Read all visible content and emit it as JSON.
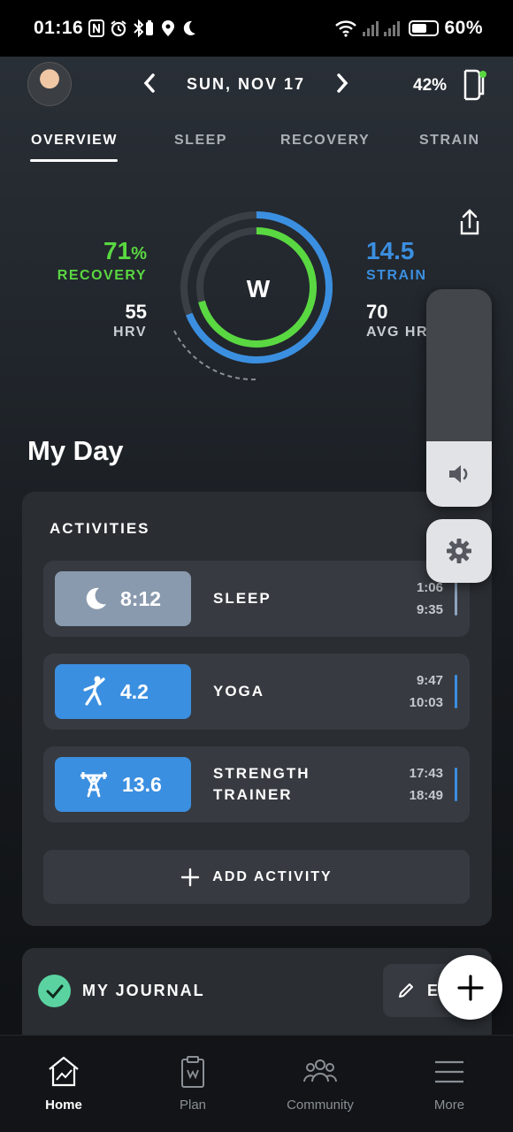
{
  "status_bar": {
    "time": "01:16",
    "battery_percent": "60%",
    "battery_level": 0.6,
    "icons": [
      "nfc-icon",
      "alarm-icon",
      "bluetooth-battery-icon",
      "location-icon",
      "moon-icon",
      "wifi-icon",
      "signal-icon",
      "signal-icon",
      "battery-icon"
    ]
  },
  "header": {
    "date": "SUN, NOV 17",
    "device_battery": "42%"
  },
  "tabs": [
    {
      "label": "OVERVIEW",
      "active": true
    },
    {
      "label": "SLEEP",
      "active": false
    },
    {
      "label": "RECOVERY",
      "active": false
    },
    {
      "label": "STRAIN",
      "active": false
    }
  ],
  "overview": {
    "recovery_value": "71",
    "recovery_unit": "%",
    "recovery_label": "RECOVERY",
    "hrv_value": "55",
    "hrv_label": "HRV",
    "strain_value": "14.5",
    "strain_label": "STRAIN",
    "avg_hr_value": "70",
    "avg_hr_label": "AVG HR",
    "logo": "W",
    "recovery_fraction": 0.71,
    "strain_fraction": 0.69,
    "colors": {
      "recovery": "#5ad841",
      "strain": "#3b8fe0"
    }
  },
  "volume_overlay": {
    "level": 0.3
  },
  "my_day": {
    "title": "My Day",
    "activities_title": "ACTIVITIES",
    "activities": [
      {
        "icon": "moon-icon",
        "value": "8:12",
        "name": "SLEEP",
        "start": "1:06",
        "end": "9:35",
        "badge_color": "#8a9aae"
      },
      {
        "icon": "yoga-icon",
        "value": "4.2",
        "name": "YOGA",
        "start": "9:47",
        "end": "10:03",
        "badge_color": "#3b8fe0"
      },
      {
        "icon": "weightlifting-icon",
        "value": "13.6",
        "name_line1": "STRENGTH",
        "name_line2": "TRAINER",
        "start": "17:43",
        "end": "18:49",
        "badge_color": "#3b8fe0"
      }
    ],
    "add_activity_label": "ADD ACTIVITY",
    "journal_title": "MY JOURNAL",
    "edit_label": "E"
  },
  "bottom_nav": [
    {
      "label": "Home",
      "icon": "home-chart-icon",
      "active": true
    },
    {
      "label": "Plan",
      "icon": "clipboard-icon",
      "active": false
    },
    {
      "label": "Community",
      "icon": "people-icon",
      "active": false
    },
    {
      "label": "More",
      "icon": "menu-icon",
      "active": false
    }
  ]
}
